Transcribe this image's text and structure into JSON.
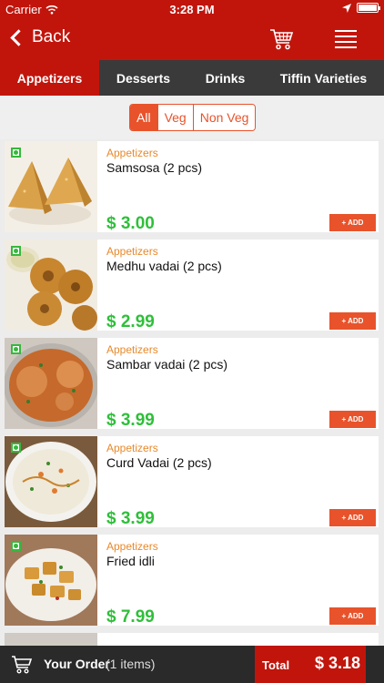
{
  "status_bar": {
    "carrier": "Carrier",
    "time": "3:28 PM"
  },
  "nav": {
    "back_label": "Back"
  },
  "tabs": [
    {
      "label": "Appetizers",
      "active": true
    },
    {
      "label": "Desserts",
      "active": false
    },
    {
      "label": "Drinks",
      "active": false
    },
    {
      "label": "Tiffin Varieties",
      "active": false
    }
  ],
  "filter": {
    "options": [
      "All",
      "Veg",
      "Non Veg"
    ],
    "selected": "All"
  },
  "items": [
    {
      "category": "Appetizers",
      "name": "Samsosa (2 pcs)",
      "price": "$ 3.00",
      "add_label": "+ ADD"
    },
    {
      "category": "Appetizers",
      "name": "Medhu vadai (2 pcs)",
      "price": "$ 2.99",
      "add_label": "+ ADD"
    },
    {
      "category": "Appetizers",
      "name": "Sambar vadai (2 pcs)",
      "price": "$ 3.99",
      "add_label": "+ ADD"
    },
    {
      "category": "Appetizers",
      "name": "Curd Vadai (2 pcs)",
      "price": "$ 3.99",
      "add_label": "+ ADD"
    },
    {
      "category": "Appetizers",
      "name": "Fried idli",
      "price": "$ 7.99",
      "add_label": "+ ADD"
    }
  ],
  "bottom_bar": {
    "order_label": "Your Order",
    "order_count": "(1 items)",
    "total_label": "Total",
    "total_amount": "$ 3.18"
  },
  "colors": {
    "brand_red": "#c1150c",
    "accent_orange": "#e8532b",
    "price_green": "#2fbf3a",
    "veg_green": "#35b83c"
  },
  "icons": [
    "wifi-icon",
    "location-arrow-icon",
    "battery-icon",
    "back-chevron-icon",
    "cart-icon",
    "hamburger-menu-icon",
    "veg-indicator-icon",
    "order-cart-icon"
  ]
}
